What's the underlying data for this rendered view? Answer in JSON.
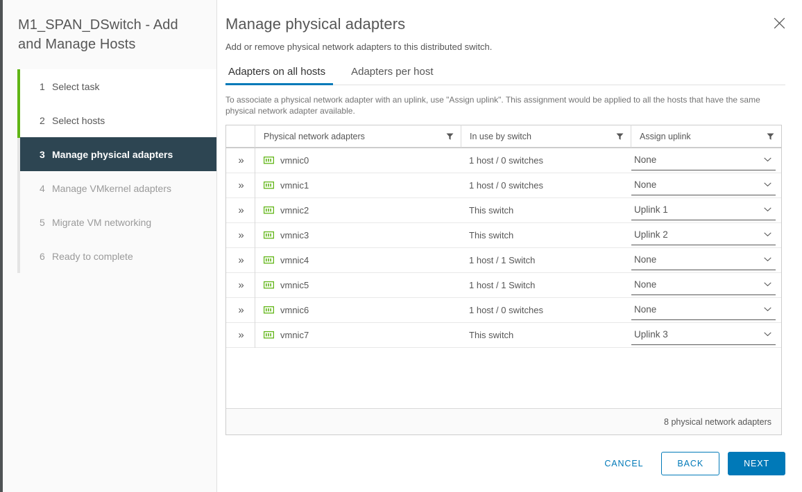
{
  "wizard": {
    "title": "M1_SPAN_DSwitch - Add and Manage Hosts",
    "steps": [
      {
        "num": "1",
        "label": "Select task",
        "state": "done"
      },
      {
        "num": "2",
        "label": "Select hosts",
        "state": "done"
      },
      {
        "num": "3",
        "label": "Manage physical adapters",
        "state": "active"
      },
      {
        "num": "4",
        "label": "Manage VMkernel adapters",
        "state": "pending"
      },
      {
        "num": "5",
        "label": "Migrate VM networking",
        "state": "pending"
      },
      {
        "num": "6",
        "label": "Ready to complete",
        "state": "pending"
      }
    ]
  },
  "panel": {
    "title": "Manage physical adapters",
    "subtitle": "Add or remove physical network adapters to this distributed switch.",
    "close_icon": "close-icon",
    "tabs": [
      {
        "label": "Adapters on all hosts",
        "active": true
      },
      {
        "label": "Adapters per host",
        "active": false
      }
    ],
    "hint": "To associate a physical network adapter with an uplink, use \"Assign uplink\". This assignment would be applied to all the hosts that have the same physical network adapter available."
  },
  "table": {
    "columns": [
      {
        "label": "",
        "filter": false
      },
      {
        "label": "Physical network adapters",
        "filter": true
      },
      {
        "label": "In use by switch",
        "filter": true
      },
      {
        "label": "Assign uplink",
        "filter": true
      }
    ],
    "expand_icon": "double-chevron-right-icon",
    "adapter_icon": "network-adapter-icon",
    "caret_icon": "chevron-down-icon",
    "rows": [
      {
        "adapter": "vmnic0",
        "in_use": "1 host / 0 switches",
        "uplink": "None"
      },
      {
        "adapter": "vmnic1",
        "in_use": "1 host / 0 switches",
        "uplink": "None"
      },
      {
        "adapter": "vmnic2",
        "in_use": "This switch",
        "uplink": "Uplink 1"
      },
      {
        "adapter": "vmnic3",
        "in_use": "This switch",
        "uplink": "Uplink 2"
      },
      {
        "adapter": "vmnic4",
        "in_use": "1 host / 1 Switch",
        "uplink": "None"
      },
      {
        "adapter": "vmnic5",
        "in_use": "1 host / 1 Switch",
        "uplink": "None"
      },
      {
        "adapter": "vmnic6",
        "in_use": "1 host / 0 switches",
        "uplink": "None"
      },
      {
        "adapter": "vmnic7",
        "in_use": "This switch",
        "uplink": "Uplink 3"
      }
    ],
    "footer_count": "8 physical network adapters"
  },
  "actions": {
    "cancel": "CANCEL",
    "back": "BACK",
    "next": "NEXT"
  },
  "colors": {
    "accent_blue": "#0079b8",
    "step_done_green": "#60b515",
    "step_active_bg": "#2d4552",
    "nic_green": "#60b515"
  }
}
